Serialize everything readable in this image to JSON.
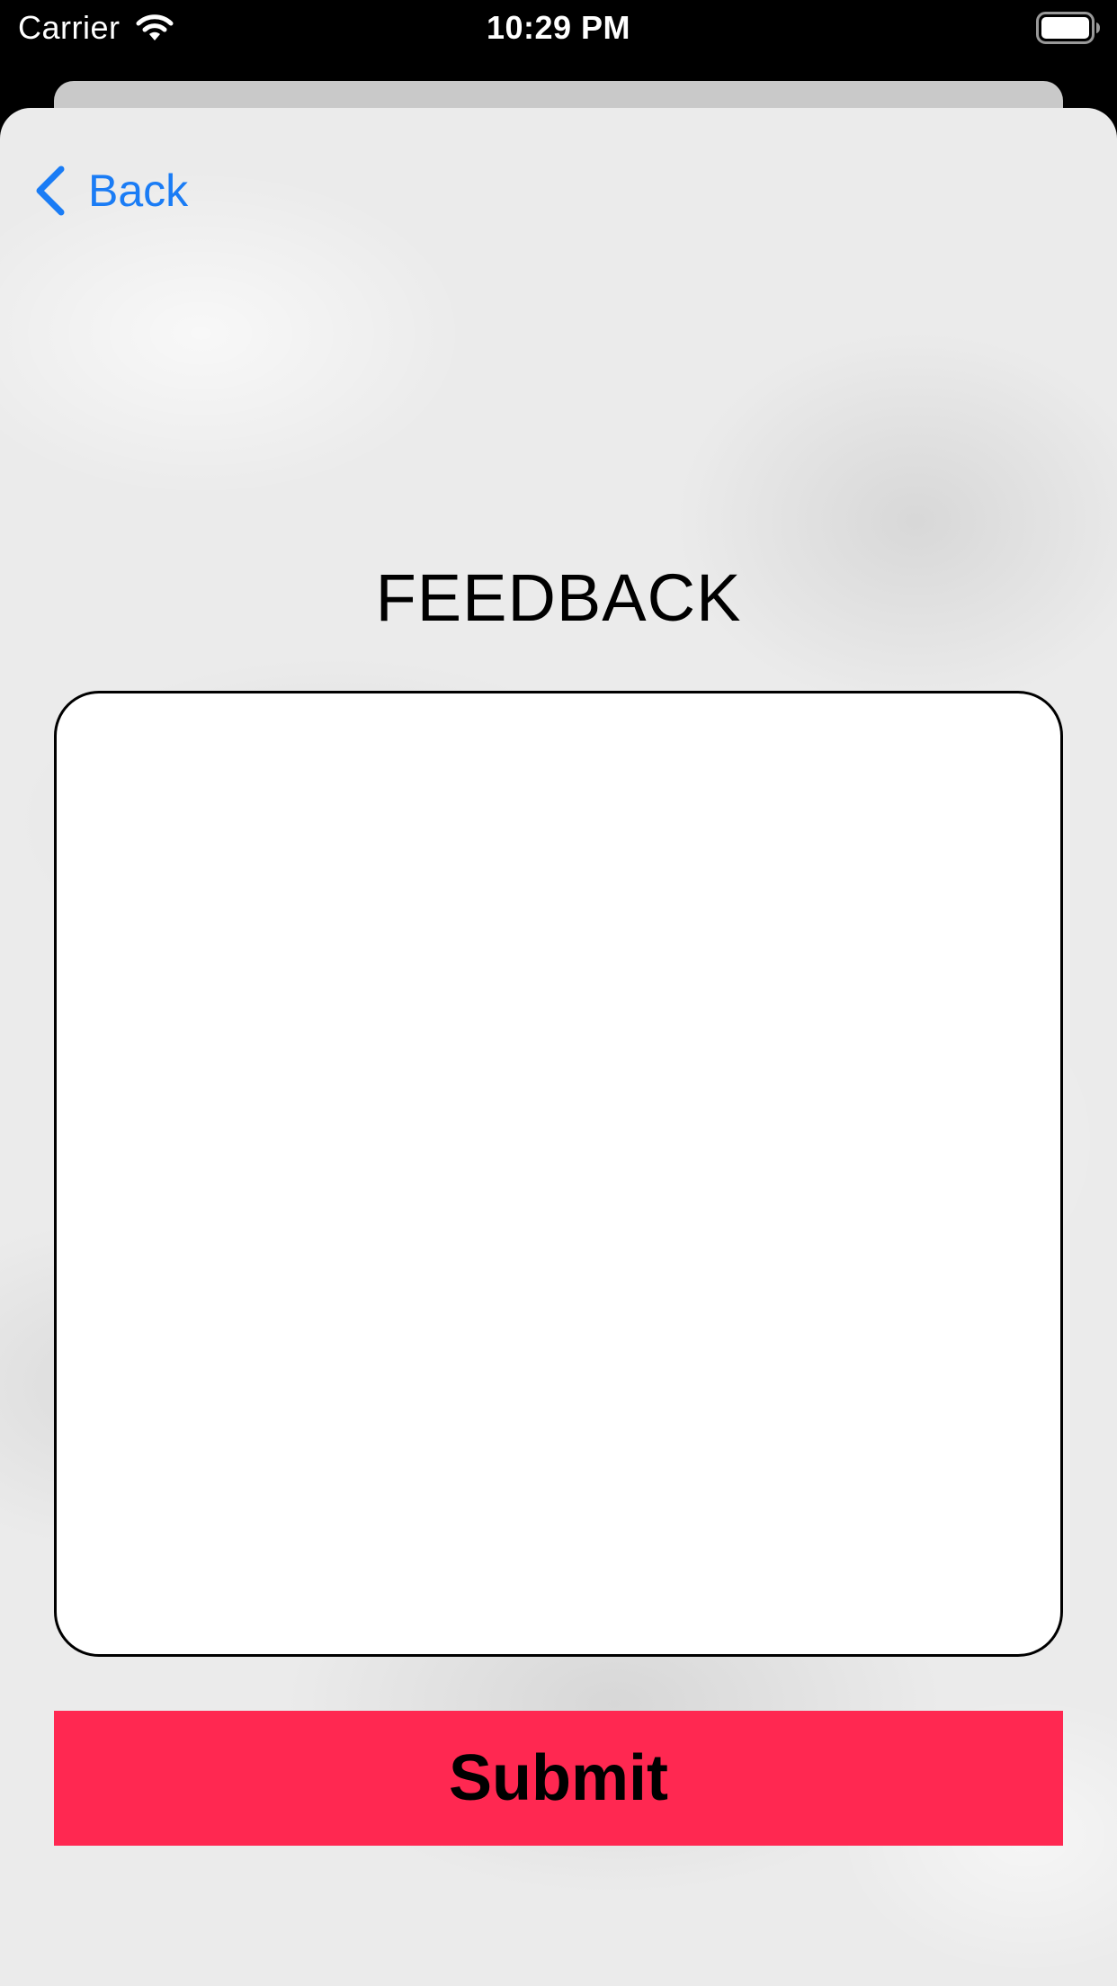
{
  "status_bar": {
    "carrier": "Carrier",
    "time": "10:29 PM",
    "icons": [
      "wifi-icon",
      "battery-icon"
    ]
  },
  "nav": {
    "back_label": "Back",
    "back_icon": "chevron-left-icon"
  },
  "title": "FEEDBACK",
  "feedback_input": {
    "value": "",
    "placeholder": ""
  },
  "submit_label": "Submit",
  "colors": {
    "accent_blue": "#1a7cf5",
    "submit_background": "#ff2851",
    "submit_text": "#000000",
    "status_bar_background": "#000000"
  }
}
